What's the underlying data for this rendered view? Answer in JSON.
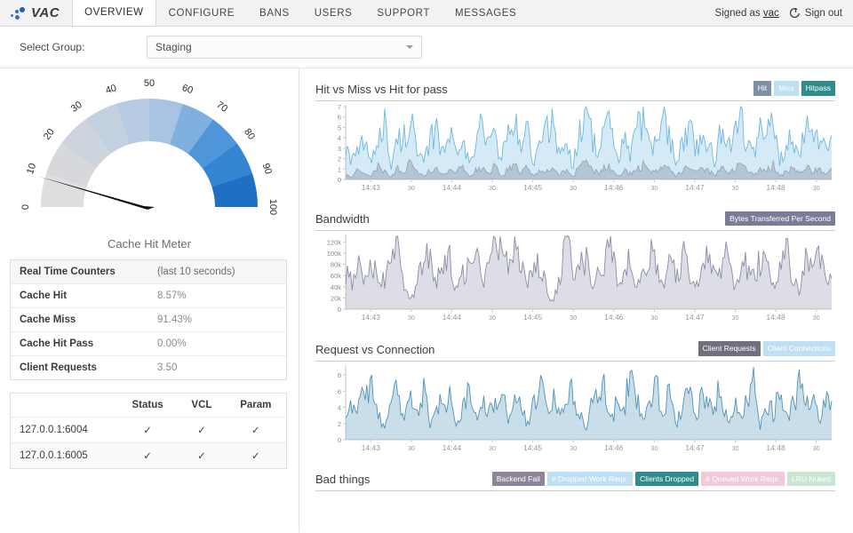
{
  "brand": {
    "name": "VAC",
    "logo_icon": "vac-dots-logo"
  },
  "nav": {
    "tabs": [
      {
        "label": "OVERVIEW",
        "active": true
      },
      {
        "label": "CONFIGURE",
        "active": false
      },
      {
        "label": "BANS",
        "active": false
      },
      {
        "label": "USERS",
        "active": false
      },
      {
        "label": "SUPPORT",
        "active": false
      },
      {
        "label": "MESSAGES",
        "active": false
      }
    ],
    "signed_as_prefix": "Signed as",
    "signed_as_user": "vac",
    "signout_label": "Sign out",
    "signout_icon": "sign-out-icon"
  },
  "groupbar": {
    "label": "Select Group:",
    "selected": "Staging",
    "caret_icon": "chevron-down-icon"
  },
  "gauge": {
    "caption": "Cache Hit Meter",
    "value": 8.57,
    "min": 0,
    "max": 100,
    "ticks": [
      "0",
      "10",
      "20",
      "30",
      "40",
      "50",
      "60",
      "70",
      "80",
      "90",
      "100"
    ],
    "segment_colors": [
      "#dedede",
      "#d6d8dc",
      "#ccd4dd",
      "#c2d0e0",
      "#b7cbe2",
      "#a9c4e2",
      "#7fb0e0",
      "#4f95da",
      "#3485d2",
      "#1f6fc4"
    ]
  },
  "counters": {
    "title": "Real Time Counters",
    "subtitle": "(last 10 seconds)",
    "rows": [
      {
        "name": "Cache Hit",
        "value": "8.57%"
      },
      {
        "name": "Cache Miss",
        "value": "91.43%"
      },
      {
        "name": "Cache Hit Pass",
        "value": "0.00%"
      },
      {
        "name": "Client Requests",
        "value": "3.50"
      }
    ]
  },
  "status_table": {
    "columns": [
      "",
      "Status",
      "VCL",
      "Param"
    ],
    "check_icon": "check-icon",
    "rows": [
      {
        "address": "127.0.0.1:6004",
        "status": "✓",
        "vcl": "✓",
        "param": "✓"
      },
      {
        "address": "127.0.0.1:6005",
        "status": "✓",
        "vcl": "✓",
        "param": "✓"
      }
    ]
  },
  "charts": [
    {
      "title": "Hit vs Miss vs Hit for pass",
      "legend": [
        {
          "label": "Hit",
          "color": "#7f8fa6"
        },
        {
          "label": "Miss",
          "color": "#bfe0f2"
        },
        {
          "label": "Hitpass",
          "color": "#2f8c8c"
        }
      ]
    },
    {
      "title": "Bandwidth",
      "legend": [
        {
          "label": "Bytes Transferred Per Second",
          "color": "#7b7d98"
        }
      ]
    },
    {
      "title": "Request vs Connection",
      "legend": [
        {
          "label": "Client Requests",
          "color": "#6f6f7e"
        },
        {
          "label": "Client Connections",
          "color": "#bfe0f2"
        }
      ]
    },
    {
      "title": "Bad things",
      "legend": [
        {
          "label": "Backend Fail",
          "color": "#8e8598"
        },
        {
          "label": "# Dropped Work Reqs.",
          "color": "#bfe0f2"
        },
        {
          "label": "Clients Dropped",
          "color": "#2f8c8c"
        },
        {
          "label": "# Queued Work Reqs.",
          "color": "#f2c9dc"
        },
        {
          "label": "LRU Nuked",
          "color": "#c9e6d2"
        }
      ]
    }
  ],
  "chart_data": [
    {
      "type": "area",
      "title": "Hit vs Miss vs Hit for pass",
      "xlabel": "",
      "ylabel": "",
      "ylim": [
        0,
        7
      ],
      "yticks": [
        0,
        1,
        2,
        3,
        4,
        5,
        6,
        7
      ],
      "ytick_labels": [
        "0",
        "1",
        "2",
        "3",
        "4",
        "5",
        "6",
        "7"
      ],
      "xtick_labels": [
        "14:43",
        "30",
        "14:44",
        "30",
        "14:45",
        "30",
        "14:46",
        "30",
        "14:47",
        "30",
        "14:48",
        "30"
      ],
      "grid": false,
      "legend_position": "top-right",
      "series": [
        {
          "name": "Miss",
          "color": "#6fb8e0",
          "values": [
            3.2,
            1.6,
            2.6,
            3.5,
            1.2,
            4.3,
            5.5,
            1.0,
            3.6,
            4.0,
            6.0,
            2.4,
            1.4,
            3.3,
            5.0,
            2.2,
            4.4,
            3.0,
            4.6,
            1.3,
            2.9,
            5.2,
            3.4,
            4.1,
            2.0,
            3.8,
            5.6,
            2.7,
            4.9,
            1.5,
            3.1,
            4.7,
            5.3,
            2.3,
            3.7,
            1.1,
            4.2,
            7.2,
            3.9,
            2.5,
            5.1,
            4.5,
            1.8,
            3.6,
            2.1,
            4.8,
            5.7,
            2.8,
            3.2,
            6.1,
            4.0,
            1.9,
            3.3,
            5.4,
            2.6,
            4.3,
            3.5,
            1.4,
            5.0,
            2.9,
            4.6,
            6.5,
            3.1,
            2.2,
            4.4,
            3.8,
            5.9,
            1.7,
            3.0,
            4.2,
            2.4,
            5.8,
            3.6,
            4.0,
            2.7,
            3.4
          ]
        },
        {
          "name": "Hit",
          "color": "#9aa7b5",
          "values": [
            0.4,
            0.2,
            1.0,
            0.6,
            0.3,
            1.3,
            0.8,
            0.2,
            1.1,
            0.5,
            1.6,
            0.7,
            0.3,
            0.9,
            1.2,
            0.4,
            1.0,
            0.6,
            1.4,
            0.2,
            0.8,
            1.1,
            0.5,
            1.3,
            0.3,
            0.9,
            1.5,
            0.6,
            1.2,
            0.4,
            0.7,
            1.0,
            1.3,
            0.5,
            0.8,
            0.2,
            1.1,
            1.8,
            0.9,
            0.6,
            1.2,
            1.0,
            0.4,
            0.8,
            0.5,
            1.1,
            1.3,
            0.6,
            0.7,
            1.4,
            0.9,
            0.3,
            0.8,
            1.2,
            0.6,
            1.0,
            0.8,
            0.3,
            1.1,
            0.7,
            1.0,
            1.5,
            0.7,
            0.5,
            1.0,
            0.9,
            1.3,
            0.4,
            0.7,
            1.0,
            0.6,
            1.3,
            0.8,
            0.9,
            0.6,
            0.8
          ]
        },
        {
          "name": "Hitpass",
          "color": "#2f8c8c",
          "values": []
        }
      ]
    },
    {
      "type": "area",
      "title": "Bandwidth",
      "xlabel": "",
      "ylabel": "",
      "ylim": [
        0,
        130000
      ],
      "yticks": [
        0,
        20000,
        40000,
        60000,
        80000,
        100000,
        120000
      ],
      "ytick_labels": [
        "0",
        "20k",
        "40k",
        "60k",
        "80k",
        "100k",
        "120k"
      ],
      "xtick_labels": [
        "14:43",
        "30",
        "14:44",
        "30",
        "14:45",
        "30",
        "14:46",
        "30",
        "14:47",
        "30",
        "14:48",
        "30"
      ],
      "grid": false,
      "legend_position": "top-right",
      "series": [
        {
          "name": "Bytes Transferred Per Second",
          "color": "#8b8da8",
          "values": [
            62000,
            48000,
            72000,
            56000,
            80000,
            60000,
            45000,
            88000,
            110000,
            30000,
            18000,
            42000,
            100000,
            78000,
            55000,
            68000,
            84000,
            40000,
            58000,
            74000,
            96000,
            50000,
            66000,
            108000,
            130000,
            88000,
            104000,
            70000,
            46000,
            60000,
            82000,
            36000,
            8000,
            54000,
            120000,
            72000,
            64000,
            90000,
            44000,
            58000,
            76000,
            112000,
            50000,
            66000,
            84000,
            38000,
            60000,
            92000,
            70000,
            48000,
            80000,
            54000,
            100000,
            62000,
            42000,
            74000,
            88000,
            56000,
            68000,
            96000,
            34000,
            60000,
            78000,
            50000,
            84000,
            66000,
            40000,
            72000,
            106000,
            58000,
            30000,
            80000,
            64000,
            92000,
            54000,
            62000
          ]
        }
      ]
    },
    {
      "type": "area",
      "title": "Request vs Connection",
      "xlabel": "",
      "ylabel": "",
      "ylim": [
        0,
        9
      ],
      "yticks": [
        0,
        2,
        4,
        6,
        8
      ],
      "ytick_labels": [
        "0",
        "2",
        "4",
        "6",
        "8"
      ],
      "xtick_labels": [
        "14:43",
        "30",
        "14:44",
        "30",
        "14:45",
        "30",
        "14:46",
        "30",
        "14:47",
        "30",
        "14:48",
        "30"
      ],
      "grid": false,
      "legend_position": "top-right",
      "series": [
        {
          "name": "Client Requests",
          "color": "#4f93b8",
          "values": [
            3.8,
            4.4,
            5.0,
            4.2,
            7.0,
            3.0,
            1.2,
            4.6,
            6.4,
            2.4,
            5.2,
            3.4,
            6.0,
            2.0,
            4.8,
            3.6,
            5.6,
            1.4,
            4.0,
            6.2,
            2.8,
            5.0,
            3.2,
            4.4,
            6.8,
            2.2,
            5.4,
            3.8,
            1.8,
            4.6,
            7.4,
            3.0,
            5.8,
            2.6,
            4.2,
            6.0,
            3.4,
            1.0,
            5.2,
            4.0,
            6.6,
            2.4,
            4.8,
            3.6,
            8.4,
            5.0,
            2.0,
            4.4,
            6.2,
            3.2,
            5.6,
            1.6,
            4.0,
            6.4,
            2.8,
            5.2,
            3.8,
            4.6,
            6.0,
            2.2,
            5.0,
            3.4,
            4.2,
            6.6,
            1.4,
            4.8,
            3.0,
            5.4,
            2.6,
            4.0,
            6.2,
            3.6,
            5.0,
            2.4,
            4.4,
            3.8
          ]
        },
        {
          "name": "Client Connections",
          "color": "#bfe0f2",
          "values": []
        }
      ]
    }
  ]
}
